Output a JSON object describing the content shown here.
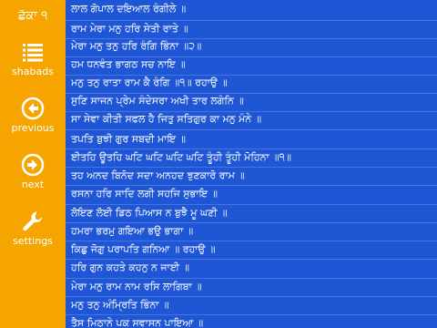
{
  "sidebar": {
    "title": "ਛੱਕਾ ੧",
    "items": [
      {
        "label": "shabads",
        "icon": "list-icon"
      },
      {
        "label": "previous",
        "icon": "arrow-left-circle-icon"
      },
      {
        "label": "next",
        "icon": "arrow-right-circle-icon"
      },
      {
        "label": "settings",
        "icon": "wrench-icon"
      }
    ]
  },
  "colors": {
    "sidebar_bg": "#f6a400",
    "content_bg": "#1f56d6",
    "text": "#ffffff"
  },
  "lines": [
    "ਲਾਲ ਗੋਪਾਲ ਦਇਆਲ ਰੰਗੀਲੇ ॥",
    "ਰਾਮ ਮੇਰਾ ਮਨੁ ਹਰਿ ਸੇਤੀ ਰਾਤੇ ॥",
    "ਮੇਰਾ ਮਨੁ ਤਨੁ ਹਰਿ ਰੰਗਿ ਭਿੰਨਾ ॥੨॥",
    "ਹਮ ਧਨਵੰਤ ਭਾਗਠ ਸਚ ਨਾਇ ॥",
    "ਮਨੁ ਤਨੁ ਰਾਤਾ ਰਾਮ ਕੈ ਰੰਗਿ ॥੧॥ ਰਹਾਉ ॥",
    "ਸੁਣਿ ਸਾਜਨ ਪ੍ਰੇਮ ਸੰਦੇਸਰਾ ਅਖੀ ਤਾਰ ਲਗੰਨਿ ॥",
    "ਸਾ ਸੇਵਾ ਕੀਤੀ ਸਫਲ ਹੈ ਜਿਤੁ ਸਤਿਗੁਰ ਕਾ ਮਨੁ ਮੰਨੇ ॥",
    "ਤਪਤਿ ਬੁਝੀ ਗੁਰ ਸਬਦੀ ਮਾਇ ॥",
    "ਈਤਹਿ ਊਤਹਿ ਘਟਿ ਘਟਿ ਘਟਿ ਘਟਿ ਤੂੰਹੀ ਤੂੰਹੀ ਮੋਹਿਨਾ ॥੧॥",
    "ਤਹ ਅਨਦ ਬਿਨੋਦ ਸਦਾ ਅਨਹਦ ਝੁਣਕਾਰੋ ਰਾਮ ॥",
    "ਰਸਨਾ ਹਰਿ ਸਾਦਿ ਲਗੀ ਸਹਜਿ ਸੁਭਾਇ ॥",
    "ਲੋਇਣ ਲੋਈ ਡਿਠ ਪਿਆਸ ਨ ਬੁਝੈ ਮੂ ਘਣੀ ॥",
    "ਹਮਰਾ ਭਰਮੁ ਗਇਆ ਭਉ ਭਾਗਾ ॥",
    "ਕਿਛੁ ਜੋਗੁ ਪਰਾਪਤਿ ਗਨਿਆ ॥ ਰਹਾਉ ॥",
    "ਹਰਿ ਗੁਨ ਕਹਤੇ ਕਹਨੁ ਨ ਜਾਈ ॥",
    "ਮੇਰਾ ਮਨੁ ਰਾਮ ਨਾਮ ਰਸਿ ਲਾਗਿਬਾ ॥",
    "ਮਨੁ ਤਨੁ ਅੰਮ੍ਰਿਤਿ ਭਿੰਨਾ ॥",
    "ਤੈਸ ਮਿਠਾਨੇ ਪਕ ਸਵਾਸਨ ਪਾਇਆ ॥"
  ]
}
